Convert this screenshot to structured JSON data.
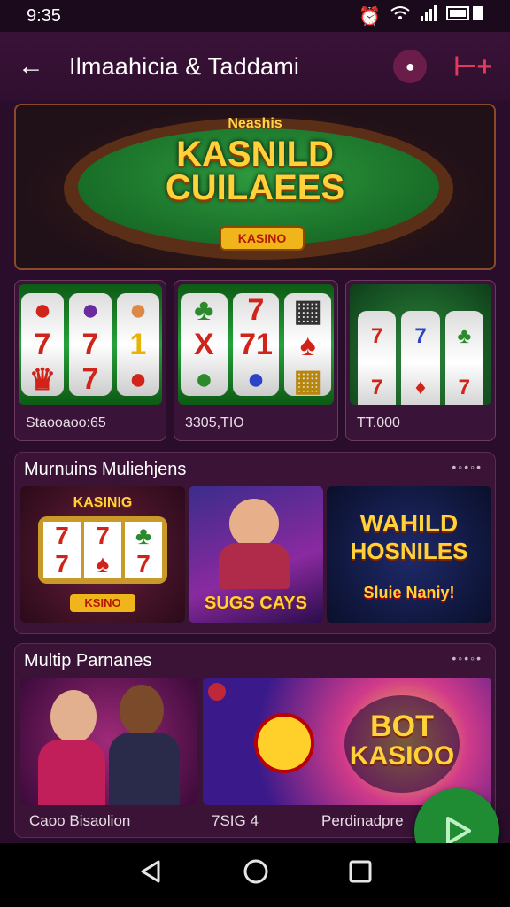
{
  "status": {
    "time": "9:35",
    "icons": [
      "alarm-icon",
      "wifi-icon",
      "signal-icon",
      "battery-icon"
    ]
  },
  "appbar": {
    "title": "Ilmaahicia & Taddami",
    "back_icon": "arrow-left-icon",
    "action1_icon": "chat-icon",
    "action2_icon": "plus-icon"
  },
  "hero": {
    "subtitle": "Neashis",
    "title": "KASNILD\nCUILAEES",
    "badge": "KASINO"
  },
  "row1": {
    "items": [
      {
        "caption": "Staooaoo:65"
      },
      {
        "caption": "3305,TIO"
      },
      {
        "caption": "TT.000"
      }
    ]
  },
  "section1": {
    "title": "Murnuins Muliehjens",
    "tiles": [
      {
        "label_top": "KASINIG",
        "label_bottom": "KSINO"
      },
      {
        "label": "SUGS CAYS"
      },
      {
        "label_top": "WAHILD",
        "label_mid": "HOSNILES",
        "label_bottom": "Sluie Naniy!"
      }
    ]
  },
  "section2": {
    "title": "Multip Parnanes",
    "tiles": [
      {
        "caption": "Caoo Bisaolion"
      },
      {
        "caption": "7SIG 4",
        "caption2": "Perdinadpre",
        "title_top": "BOT",
        "title_bottom": "KASIOO"
      }
    ]
  },
  "fab": {
    "icon": "play-icon"
  },
  "nav": {
    "icons": [
      "back-triangle-icon",
      "home-circle-icon",
      "recents-square-icon"
    ]
  },
  "colors": {
    "accent": "#1f8c34",
    "background": "#2a0d2b",
    "gold": "#ffd23a"
  }
}
